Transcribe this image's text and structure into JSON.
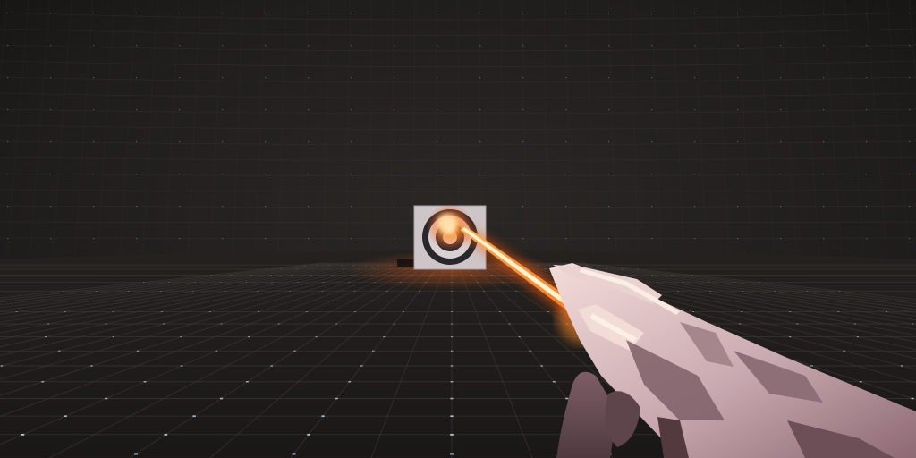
{
  "scene": {
    "view": "first-person",
    "environment": "grid-room",
    "colors": {
      "background": "#1f1d1c",
      "grid_line": "#3b3734",
      "grid_dot": "#cfd6e6",
      "beam_core": "#fff3c4",
      "beam_glow": "#ff7a1f",
      "target_board": "#cfc7c8",
      "target_ring": "#26262b",
      "weapon_body": "#c9b2b7",
      "weapon_shadow": "#6b4d55",
      "weapon_highlight": "#f6ded8"
    },
    "target": {
      "icon": "bullseye-target",
      "hit_glow": true
    },
    "weapon": {
      "icon": "laser-rifle",
      "firing": true
    },
    "hud": {
      "crosshair": false,
      "text": []
    }
  }
}
